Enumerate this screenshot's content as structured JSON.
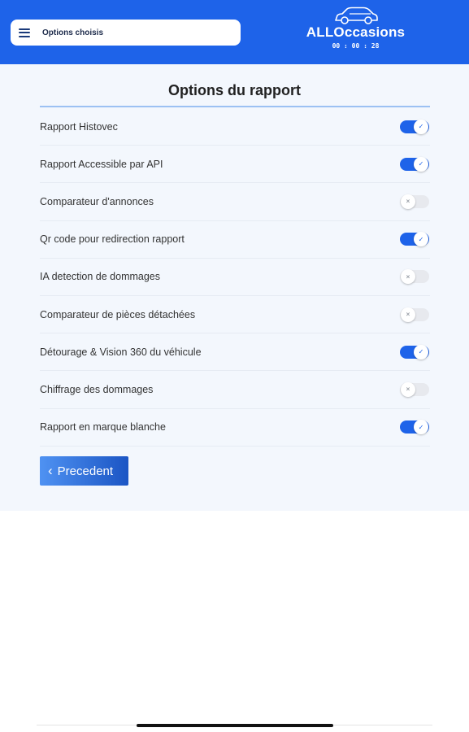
{
  "header": {
    "menu_label": "Options choisis",
    "brand": "ALLOccasions",
    "timer": "00 : 00 : 28",
    "color": "#1e63e9"
  },
  "main": {
    "title": "Options du rapport",
    "options": [
      {
        "label": "Rapport Histovec",
        "enabled": true
      },
      {
        "label": "Rapport Accessible par API",
        "enabled": true
      },
      {
        "label": "Comparateur d'annonces",
        "enabled": false
      },
      {
        "label": "Qr code pour redirection rapport",
        "enabled": true
      },
      {
        "label": "IA detection de dommages",
        "enabled": false
      },
      {
        "label": "Comparateur de pièces détachées",
        "enabled": false
      },
      {
        "label": "Détourage & Vision 360 du véhicule",
        "enabled": true
      },
      {
        "label": "Chiffrage des dommages",
        "enabled": false
      },
      {
        "label": "Rapport en marque blanche",
        "enabled": true
      }
    ],
    "previous_label": "Precedent"
  },
  "icons": {
    "menu": "hamburger-icon",
    "logo": "car-outline-icon",
    "toggle_on": "check-icon",
    "toggle_off": "x-icon",
    "back": "chevron-left-icon"
  }
}
